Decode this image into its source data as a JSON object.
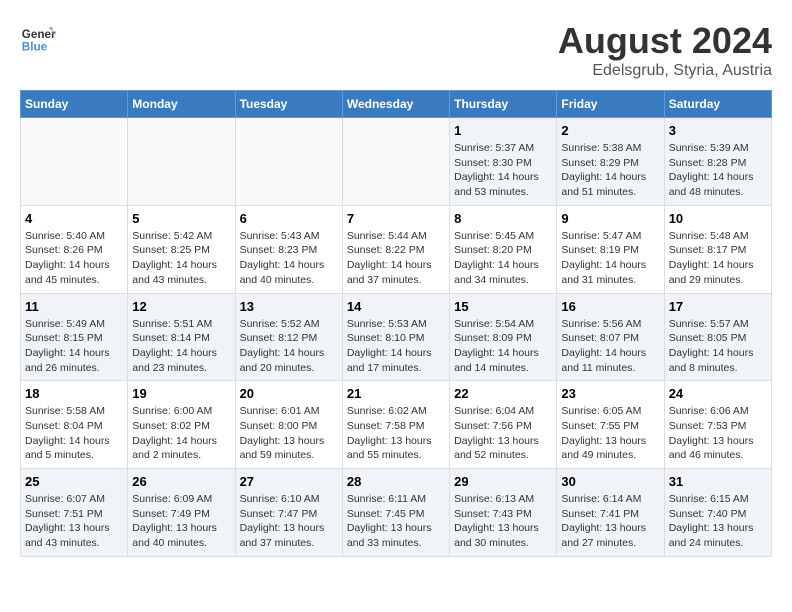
{
  "header": {
    "logo_line1": "General",
    "logo_line2": "Blue",
    "title": "August 2024",
    "subtitle": "Edelsgrub, Styria, Austria"
  },
  "days_of_week": [
    "Sunday",
    "Monday",
    "Tuesday",
    "Wednesday",
    "Thursday",
    "Friday",
    "Saturday"
  ],
  "weeks": [
    [
      {
        "day": "",
        "info": ""
      },
      {
        "day": "",
        "info": ""
      },
      {
        "day": "",
        "info": ""
      },
      {
        "day": "",
        "info": ""
      },
      {
        "day": "1",
        "info": "Sunrise: 5:37 AM\nSunset: 8:30 PM\nDaylight: 14 hours\nand 53 minutes."
      },
      {
        "day": "2",
        "info": "Sunrise: 5:38 AM\nSunset: 8:29 PM\nDaylight: 14 hours\nand 51 minutes."
      },
      {
        "day": "3",
        "info": "Sunrise: 5:39 AM\nSunset: 8:28 PM\nDaylight: 14 hours\nand 48 minutes."
      }
    ],
    [
      {
        "day": "4",
        "info": "Sunrise: 5:40 AM\nSunset: 8:26 PM\nDaylight: 14 hours\nand 45 minutes."
      },
      {
        "day": "5",
        "info": "Sunrise: 5:42 AM\nSunset: 8:25 PM\nDaylight: 14 hours\nand 43 minutes."
      },
      {
        "day": "6",
        "info": "Sunrise: 5:43 AM\nSunset: 8:23 PM\nDaylight: 14 hours\nand 40 minutes."
      },
      {
        "day": "7",
        "info": "Sunrise: 5:44 AM\nSunset: 8:22 PM\nDaylight: 14 hours\nand 37 minutes."
      },
      {
        "day": "8",
        "info": "Sunrise: 5:45 AM\nSunset: 8:20 PM\nDaylight: 14 hours\nand 34 minutes."
      },
      {
        "day": "9",
        "info": "Sunrise: 5:47 AM\nSunset: 8:19 PM\nDaylight: 14 hours\nand 31 minutes."
      },
      {
        "day": "10",
        "info": "Sunrise: 5:48 AM\nSunset: 8:17 PM\nDaylight: 14 hours\nand 29 minutes."
      }
    ],
    [
      {
        "day": "11",
        "info": "Sunrise: 5:49 AM\nSunset: 8:15 PM\nDaylight: 14 hours\nand 26 minutes."
      },
      {
        "day": "12",
        "info": "Sunrise: 5:51 AM\nSunset: 8:14 PM\nDaylight: 14 hours\nand 23 minutes."
      },
      {
        "day": "13",
        "info": "Sunrise: 5:52 AM\nSunset: 8:12 PM\nDaylight: 14 hours\nand 20 minutes."
      },
      {
        "day": "14",
        "info": "Sunrise: 5:53 AM\nSunset: 8:10 PM\nDaylight: 14 hours\nand 17 minutes."
      },
      {
        "day": "15",
        "info": "Sunrise: 5:54 AM\nSunset: 8:09 PM\nDaylight: 14 hours\nand 14 minutes."
      },
      {
        "day": "16",
        "info": "Sunrise: 5:56 AM\nSunset: 8:07 PM\nDaylight: 14 hours\nand 11 minutes."
      },
      {
        "day": "17",
        "info": "Sunrise: 5:57 AM\nSunset: 8:05 PM\nDaylight: 14 hours\nand 8 minutes."
      }
    ],
    [
      {
        "day": "18",
        "info": "Sunrise: 5:58 AM\nSunset: 8:04 PM\nDaylight: 14 hours\nand 5 minutes."
      },
      {
        "day": "19",
        "info": "Sunrise: 6:00 AM\nSunset: 8:02 PM\nDaylight: 14 hours\nand 2 minutes."
      },
      {
        "day": "20",
        "info": "Sunrise: 6:01 AM\nSunset: 8:00 PM\nDaylight: 13 hours\nand 59 minutes."
      },
      {
        "day": "21",
        "info": "Sunrise: 6:02 AM\nSunset: 7:58 PM\nDaylight: 13 hours\nand 55 minutes."
      },
      {
        "day": "22",
        "info": "Sunrise: 6:04 AM\nSunset: 7:56 PM\nDaylight: 13 hours\nand 52 minutes."
      },
      {
        "day": "23",
        "info": "Sunrise: 6:05 AM\nSunset: 7:55 PM\nDaylight: 13 hours\nand 49 minutes."
      },
      {
        "day": "24",
        "info": "Sunrise: 6:06 AM\nSunset: 7:53 PM\nDaylight: 13 hours\nand 46 minutes."
      }
    ],
    [
      {
        "day": "25",
        "info": "Sunrise: 6:07 AM\nSunset: 7:51 PM\nDaylight: 13 hours\nand 43 minutes."
      },
      {
        "day": "26",
        "info": "Sunrise: 6:09 AM\nSunset: 7:49 PM\nDaylight: 13 hours\nand 40 minutes."
      },
      {
        "day": "27",
        "info": "Sunrise: 6:10 AM\nSunset: 7:47 PM\nDaylight: 13 hours\nand 37 minutes."
      },
      {
        "day": "28",
        "info": "Sunrise: 6:11 AM\nSunset: 7:45 PM\nDaylight: 13 hours\nand 33 minutes."
      },
      {
        "day": "29",
        "info": "Sunrise: 6:13 AM\nSunset: 7:43 PM\nDaylight: 13 hours\nand 30 minutes."
      },
      {
        "day": "30",
        "info": "Sunrise: 6:14 AM\nSunset: 7:41 PM\nDaylight: 13 hours\nand 27 minutes."
      },
      {
        "day": "31",
        "info": "Sunrise: 6:15 AM\nSunset: 7:40 PM\nDaylight: 13 hours\nand 24 minutes."
      }
    ]
  ]
}
